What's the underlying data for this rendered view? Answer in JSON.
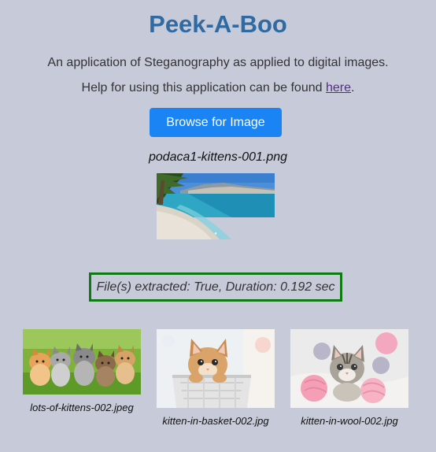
{
  "header": {
    "title": "Peek-A-Boo",
    "subtitle": "An application of Steganography as applied to digital images.",
    "help_prefix": "Help for using this application can be found ",
    "help_link": "here",
    "help_suffix": "."
  },
  "browse": {
    "label": "Browse for Image"
  },
  "selected": {
    "filename": "podaca1-kittens-001.png",
    "image_icon": "beach-photo"
  },
  "status": {
    "text": "File(s) extracted: True, Duration: 0.192 sec",
    "border_color": "#0f7a14"
  },
  "extracted": [
    {
      "filename": "lots-of-kittens-002.jpeg",
      "image_icon": "kittens-on-grass-photo"
    },
    {
      "filename": "kitten-in-basket-002.jpg",
      "image_icon": "kitten-in-basket-photo"
    },
    {
      "filename": "kitten-in-wool-002.jpg",
      "image_icon": "kitten-in-wool-photo"
    }
  ],
  "colors": {
    "background": "#c7cbd9",
    "title": "#2f6aa3",
    "button": "#1a84f5"
  }
}
